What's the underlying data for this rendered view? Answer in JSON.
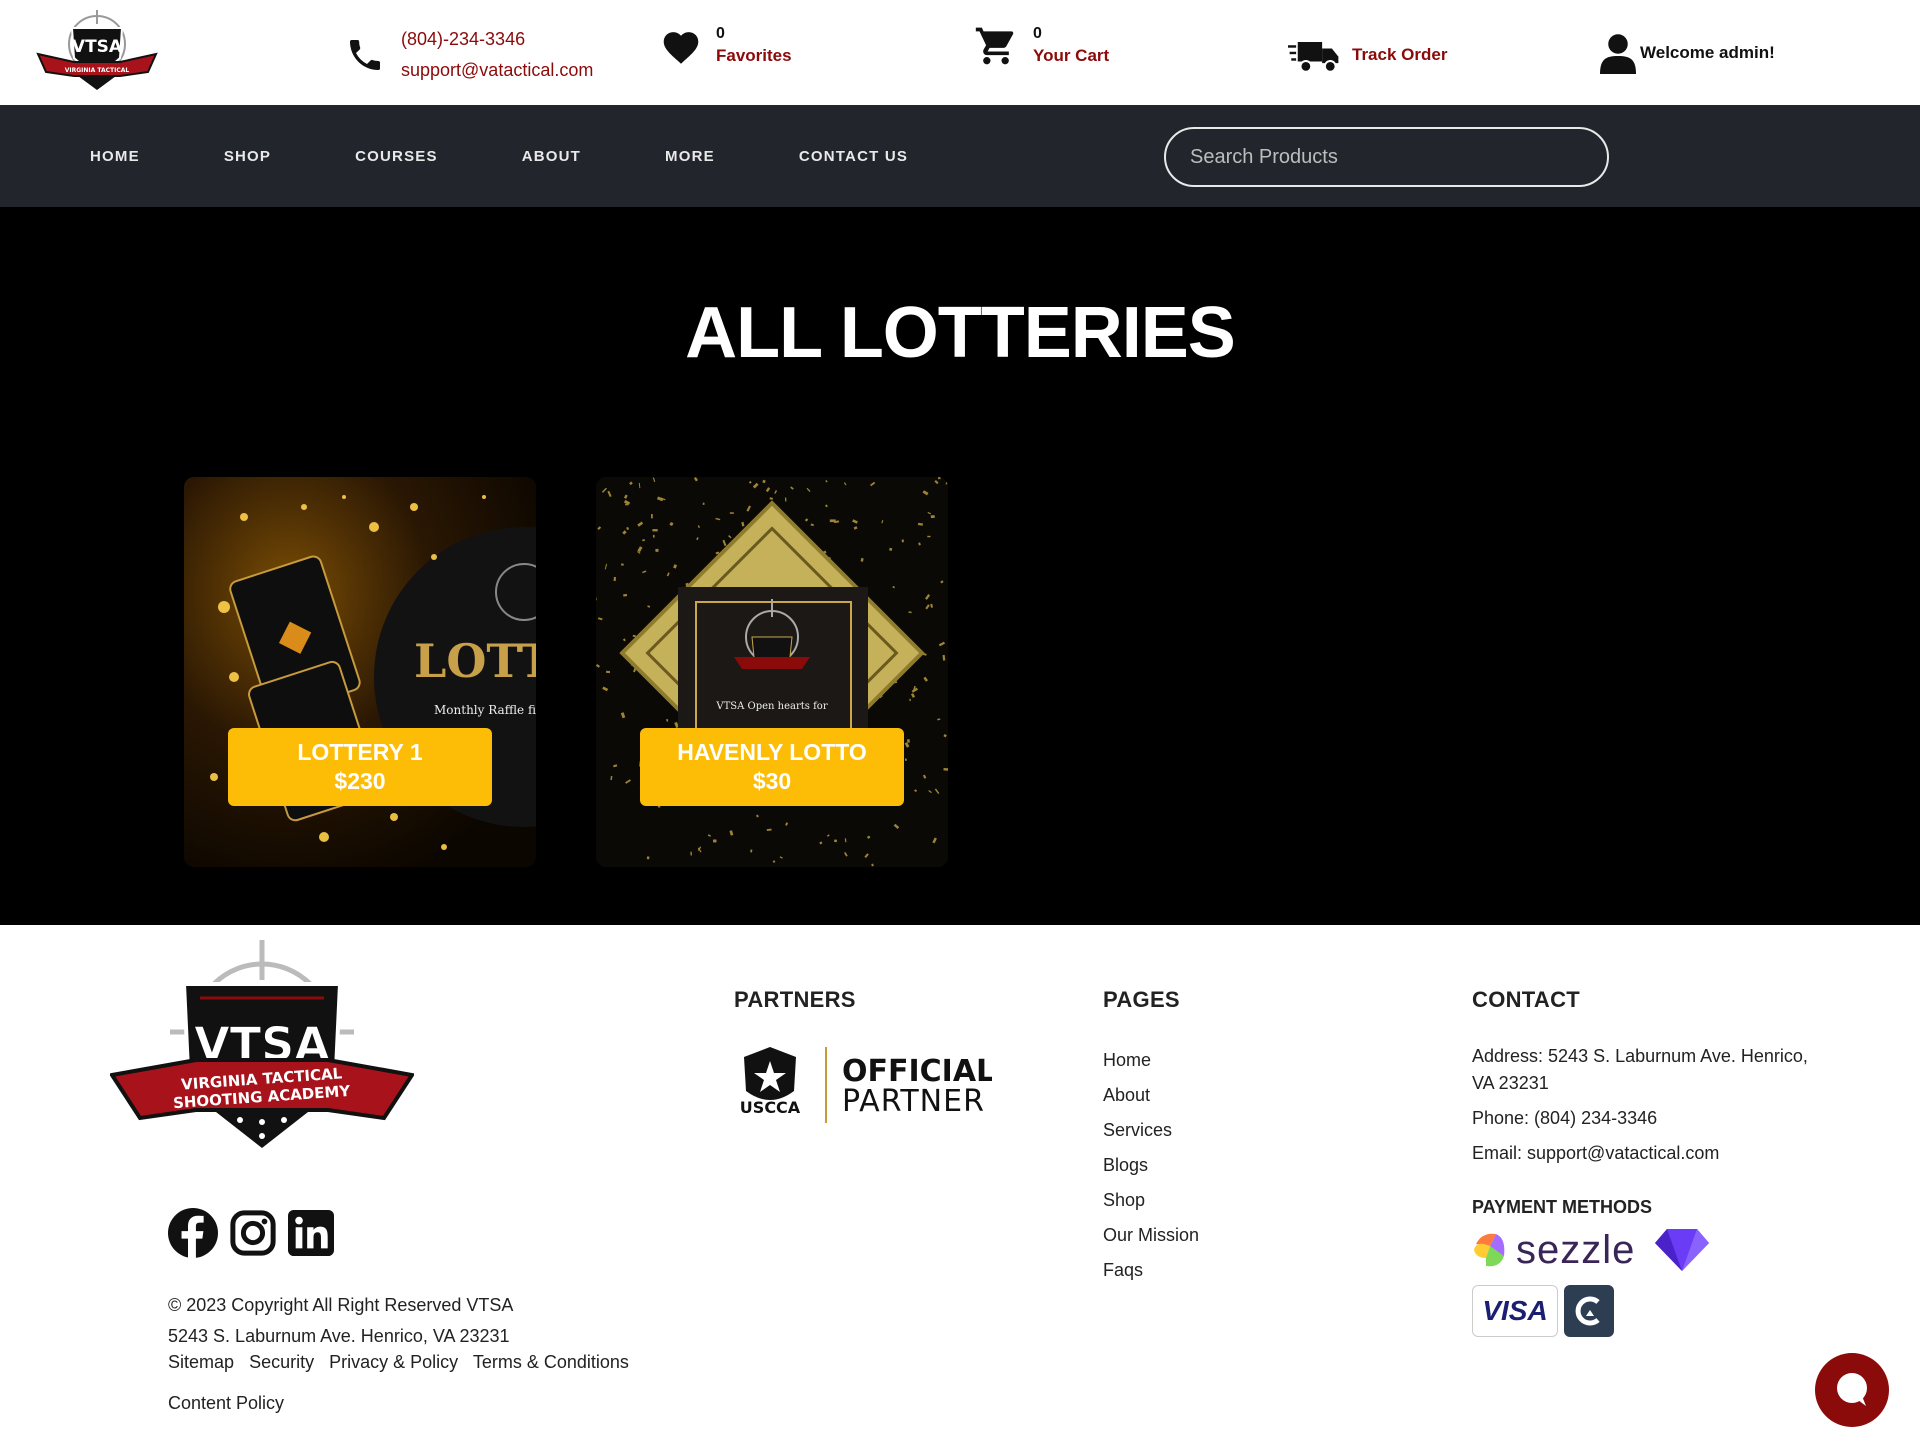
{
  "header": {
    "logo_alt": "VTSA",
    "phone": "(804)-234-3346",
    "email": "support@vatactical.com",
    "favorites_count": "0",
    "favorites_label": "Favorites",
    "cart_count": "0",
    "cart_label": "Your Cart",
    "track_label": "Track Order",
    "welcome_label": "Welcome admin!"
  },
  "nav": {
    "items": [
      "HOME",
      "SHOP",
      "COURSES",
      "ABOUT",
      "MORE",
      "CONTACT US"
    ],
    "search_placeholder": "Search Products"
  },
  "hero": {
    "title": "ALL LOTTERIES",
    "cards": [
      {
        "name": "LOTTERY 1",
        "price": "$230",
        "image_text": "LOTT",
        "image_sub": "Monthly Raffle fir"
      },
      {
        "name": "HAVENLY LOTTO",
        "price": "$30",
        "image_text": "VTSA Open hearts for"
      }
    ]
  },
  "footer": {
    "copyright": "© 2023 Copyright All Right Reserved VTSA",
    "address_line": "5243 S. Laburnum Ave. Henrico, VA 23231",
    "links": [
      "Sitemap",
      "Security",
      "Privacy & Policy",
      "Terms & Conditions",
      "Content Policy"
    ],
    "partners_heading": "PARTNERS",
    "partner_text_1": "OFFICIAL",
    "partner_text_2": "PARTNER",
    "partner_brand": "USCCA",
    "pages_heading": "PAGES",
    "pages": [
      "Home",
      "About",
      "Services",
      "Blogs",
      "Shop",
      "Our Mission",
      "Faqs"
    ],
    "contact_heading": "CONTACT",
    "contact_address": "Address: 5243 S. Laburnum Ave. Henrico, VA 23231",
    "contact_phone": "Phone: (804) 234-3346",
    "contact_email": "Email: support@vatactical.com",
    "payment_heading": "PAYMENT METHODS",
    "payment_sezzle": "sezzle",
    "payment_visa": "VISA"
  },
  "colors": {
    "brand_red": "#8b0a0a",
    "nav_bg": "#22252b",
    "badge_yellow": "#fdbd06",
    "hero_bg": "#000000"
  }
}
